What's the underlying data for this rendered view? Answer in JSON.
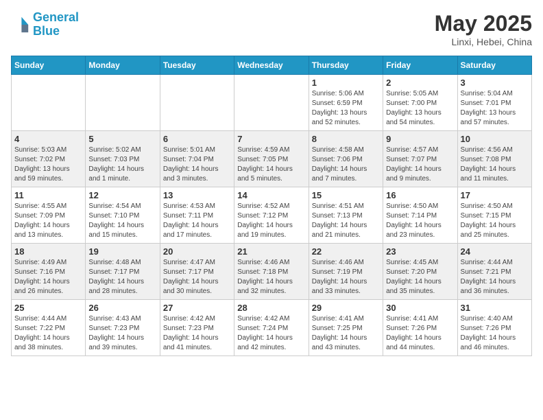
{
  "header": {
    "logo_line1": "General",
    "logo_line2": "Blue",
    "title": "May 2025",
    "subtitle": "Linxi, Hebei, China"
  },
  "weekdays": [
    "Sunday",
    "Monday",
    "Tuesday",
    "Wednesday",
    "Thursday",
    "Friday",
    "Saturday"
  ],
  "weeks": [
    [
      {
        "day": "",
        "info": ""
      },
      {
        "day": "",
        "info": ""
      },
      {
        "day": "",
        "info": ""
      },
      {
        "day": "",
        "info": ""
      },
      {
        "day": "1",
        "info": "Sunrise: 5:06 AM\nSunset: 6:59 PM\nDaylight: 13 hours\nand 52 minutes."
      },
      {
        "day": "2",
        "info": "Sunrise: 5:05 AM\nSunset: 7:00 PM\nDaylight: 13 hours\nand 54 minutes."
      },
      {
        "day": "3",
        "info": "Sunrise: 5:04 AM\nSunset: 7:01 PM\nDaylight: 13 hours\nand 57 minutes."
      }
    ],
    [
      {
        "day": "4",
        "info": "Sunrise: 5:03 AM\nSunset: 7:02 PM\nDaylight: 13 hours\nand 59 minutes."
      },
      {
        "day": "5",
        "info": "Sunrise: 5:02 AM\nSunset: 7:03 PM\nDaylight: 14 hours\nand 1 minute."
      },
      {
        "day": "6",
        "info": "Sunrise: 5:01 AM\nSunset: 7:04 PM\nDaylight: 14 hours\nand 3 minutes."
      },
      {
        "day": "7",
        "info": "Sunrise: 4:59 AM\nSunset: 7:05 PM\nDaylight: 14 hours\nand 5 minutes."
      },
      {
        "day": "8",
        "info": "Sunrise: 4:58 AM\nSunset: 7:06 PM\nDaylight: 14 hours\nand 7 minutes."
      },
      {
        "day": "9",
        "info": "Sunrise: 4:57 AM\nSunset: 7:07 PM\nDaylight: 14 hours\nand 9 minutes."
      },
      {
        "day": "10",
        "info": "Sunrise: 4:56 AM\nSunset: 7:08 PM\nDaylight: 14 hours\nand 11 minutes."
      }
    ],
    [
      {
        "day": "11",
        "info": "Sunrise: 4:55 AM\nSunset: 7:09 PM\nDaylight: 14 hours\nand 13 minutes."
      },
      {
        "day": "12",
        "info": "Sunrise: 4:54 AM\nSunset: 7:10 PM\nDaylight: 14 hours\nand 15 minutes."
      },
      {
        "day": "13",
        "info": "Sunrise: 4:53 AM\nSunset: 7:11 PM\nDaylight: 14 hours\nand 17 minutes."
      },
      {
        "day": "14",
        "info": "Sunrise: 4:52 AM\nSunset: 7:12 PM\nDaylight: 14 hours\nand 19 minutes."
      },
      {
        "day": "15",
        "info": "Sunrise: 4:51 AM\nSunset: 7:13 PM\nDaylight: 14 hours\nand 21 minutes."
      },
      {
        "day": "16",
        "info": "Sunrise: 4:50 AM\nSunset: 7:14 PM\nDaylight: 14 hours\nand 23 minutes."
      },
      {
        "day": "17",
        "info": "Sunrise: 4:50 AM\nSunset: 7:15 PM\nDaylight: 14 hours\nand 25 minutes."
      }
    ],
    [
      {
        "day": "18",
        "info": "Sunrise: 4:49 AM\nSunset: 7:16 PM\nDaylight: 14 hours\nand 26 minutes."
      },
      {
        "day": "19",
        "info": "Sunrise: 4:48 AM\nSunset: 7:17 PM\nDaylight: 14 hours\nand 28 minutes."
      },
      {
        "day": "20",
        "info": "Sunrise: 4:47 AM\nSunset: 7:17 PM\nDaylight: 14 hours\nand 30 minutes."
      },
      {
        "day": "21",
        "info": "Sunrise: 4:46 AM\nSunset: 7:18 PM\nDaylight: 14 hours\nand 32 minutes."
      },
      {
        "day": "22",
        "info": "Sunrise: 4:46 AM\nSunset: 7:19 PM\nDaylight: 14 hours\nand 33 minutes."
      },
      {
        "day": "23",
        "info": "Sunrise: 4:45 AM\nSunset: 7:20 PM\nDaylight: 14 hours\nand 35 minutes."
      },
      {
        "day": "24",
        "info": "Sunrise: 4:44 AM\nSunset: 7:21 PM\nDaylight: 14 hours\nand 36 minutes."
      }
    ],
    [
      {
        "day": "25",
        "info": "Sunrise: 4:44 AM\nSunset: 7:22 PM\nDaylight: 14 hours\nand 38 minutes."
      },
      {
        "day": "26",
        "info": "Sunrise: 4:43 AM\nSunset: 7:23 PM\nDaylight: 14 hours\nand 39 minutes."
      },
      {
        "day": "27",
        "info": "Sunrise: 4:42 AM\nSunset: 7:23 PM\nDaylight: 14 hours\nand 41 minutes."
      },
      {
        "day": "28",
        "info": "Sunrise: 4:42 AM\nSunset: 7:24 PM\nDaylight: 14 hours\nand 42 minutes."
      },
      {
        "day": "29",
        "info": "Sunrise: 4:41 AM\nSunset: 7:25 PM\nDaylight: 14 hours\nand 43 minutes."
      },
      {
        "day": "30",
        "info": "Sunrise: 4:41 AM\nSunset: 7:26 PM\nDaylight: 14 hours\nand 44 minutes."
      },
      {
        "day": "31",
        "info": "Sunrise: 4:40 AM\nSunset: 7:26 PM\nDaylight: 14 hours\nand 46 minutes."
      }
    ]
  ]
}
